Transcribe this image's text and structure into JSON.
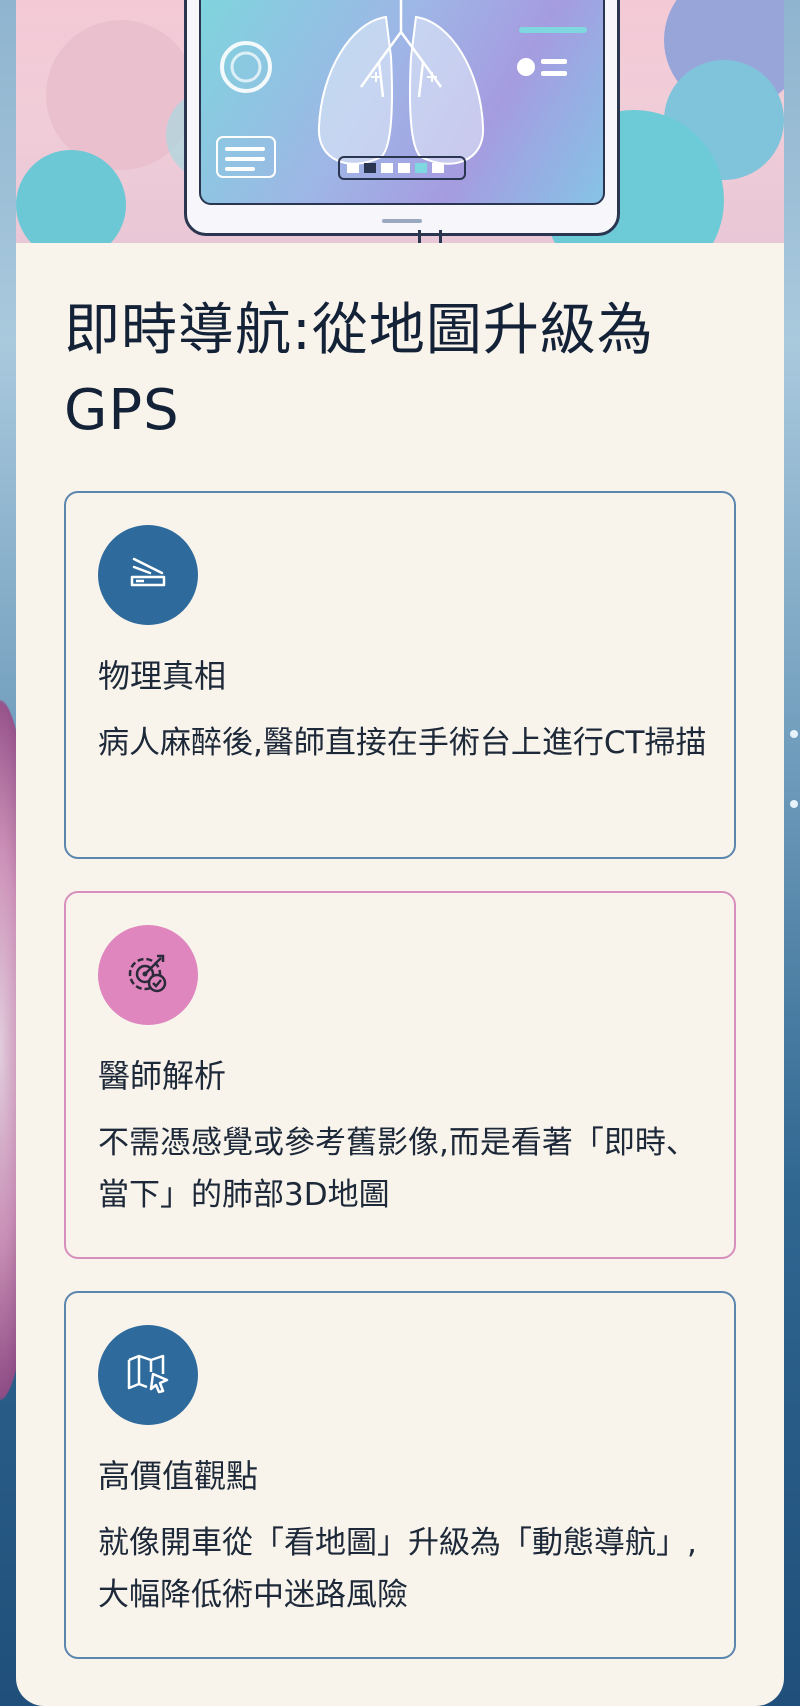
{
  "title": "即時導航:從地圖升級為GPS",
  "features": [
    {
      "icon": "scanner-icon",
      "title": "物理真相",
      "description": "病人麻醉後,醫師直接在手術台上進行CT掃描"
    },
    {
      "icon": "target-check-icon",
      "title": "醫師解析",
      "description": "不需憑感覺或參考舊影像,而是看著「即時、當下」的肺部3D地圖"
    },
    {
      "icon": "map-cursor-icon",
      "title": "高價值觀點",
      "description": "就像開車從「看地圖」升級為「動態導航」,大幅降低術中迷路風險"
    }
  ],
  "colors": {
    "primary": "#2f6a9c",
    "accent_pink": "#de86bd",
    "card_background": "#f8f4ec",
    "title_text": "#142238"
  }
}
